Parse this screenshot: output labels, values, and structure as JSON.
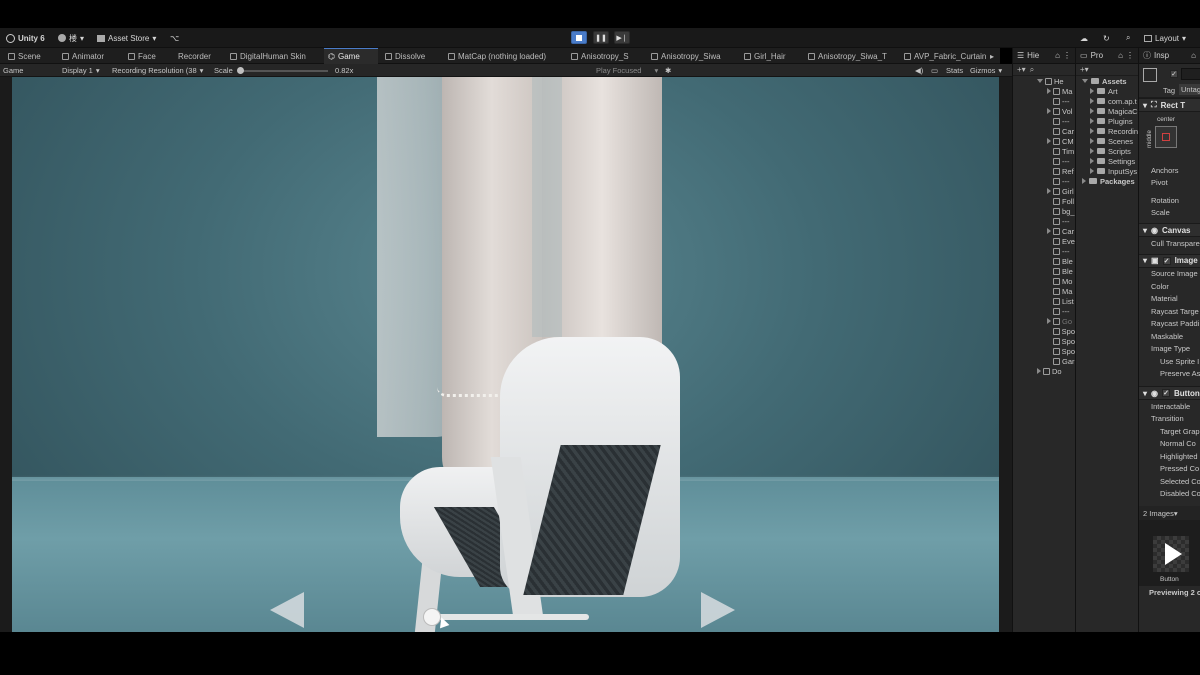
{
  "toolbar": {
    "app_name": "Unity 6",
    "account_label": "楼",
    "asset_store_label": "Asset Store",
    "layout_label": "Layout"
  },
  "tabs": [
    {
      "label": "Scene"
    },
    {
      "label": "Animator"
    },
    {
      "label": "Face"
    },
    {
      "label": "Recorder"
    },
    {
      "label": "DigitalHuman Skin"
    },
    {
      "label": "Game"
    },
    {
      "label": "Dissolve"
    },
    {
      "label": "MatCap (nothing loaded)"
    },
    {
      "label": "Anisotropy_S"
    },
    {
      "label": "Anisotropy_Siwa"
    },
    {
      "label": "Girl_Hair"
    },
    {
      "label": "Anisotropy_Siwa_T"
    },
    {
      "label": "AVP_Fabric_Curtain"
    }
  ],
  "gamebar": {
    "mode": "Game",
    "display": "Display 1",
    "resolution": "Recording Resolution (38",
    "scale_label": "Scale",
    "scale_value": "0.82x",
    "play_focused": "Play Focused",
    "stats": "Stats",
    "gizmos": "Gizmos"
  },
  "hierarchy": {
    "title": "Hie",
    "rows": [
      {
        "label": "He",
        "indent": 0,
        "fold": "open",
        "muted": false
      },
      {
        "label": "Ma",
        "indent": 1,
        "fold": "closed",
        "muted": false
      },
      {
        "label": "---",
        "indent": 1,
        "fold": "",
        "muted": false
      },
      {
        "label": "Vol",
        "indent": 1,
        "fold": "closed",
        "muted": false
      },
      {
        "label": "---",
        "indent": 1,
        "fold": "",
        "muted": false
      },
      {
        "label": "Car",
        "indent": 1,
        "fold": "",
        "muted": false
      },
      {
        "label": "CM",
        "indent": 1,
        "fold": "closed",
        "muted": false
      },
      {
        "label": "Tim",
        "indent": 1,
        "fold": "",
        "muted": false
      },
      {
        "label": "---",
        "indent": 1,
        "fold": "",
        "muted": false
      },
      {
        "label": "Ref",
        "indent": 1,
        "fold": "",
        "muted": false
      },
      {
        "label": "---",
        "indent": 1,
        "fold": "",
        "muted": false
      },
      {
        "label": "Girl",
        "indent": 1,
        "fold": "closed",
        "muted": false
      },
      {
        "label": "Foll",
        "indent": 1,
        "fold": "",
        "muted": false
      },
      {
        "label": "bg_",
        "indent": 1,
        "fold": "",
        "muted": false
      },
      {
        "label": "---",
        "indent": 1,
        "fold": "",
        "muted": false
      },
      {
        "label": "Car",
        "indent": 1,
        "fold": "closed",
        "muted": false
      },
      {
        "label": "Eve",
        "indent": 1,
        "fold": "",
        "muted": false
      },
      {
        "label": "---",
        "indent": 1,
        "fold": "",
        "muted": false
      },
      {
        "label": "Ble",
        "indent": 1,
        "fold": "",
        "muted": false
      },
      {
        "label": "Ble",
        "indent": 1,
        "fold": "",
        "muted": false
      },
      {
        "label": "Mo",
        "indent": 1,
        "fold": "",
        "muted": false
      },
      {
        "label": "Ma",
        "indent": 1,
        "fold": "",
        "muted": false
      },
      {
        "label": "List",
        "indent": 1,
        "fold": "",
        "muted": false
      },
      {
        "label": "---",
        "indent": 1,
        "fold": "",
        "muted": false
      },
      {
        "label": "Go",
        "indent": 1,
        "fold": "closed",
        "muted": true
      },
      {
        "label": "Spo",
        "indent": 1,
        "fold": "",
        "muted": false
      },
      {
        "label": "Spo",
        "indent": 1,
        "fold": "",
        "muted": false
      },
      {
        "label": "Spo",
        "indent": 1,
        "fold": "",
        "muted": false
      },
      {
        "label": "Gar",
        "indent": 1,
        "fold": "",
        "muted": false
      },
      {
        "label": "Do",
        "indent": 0,
        "fold": "closed",
        "muted": false
      }
    ]
  },
  "project": {
    "title": "Pro",
    "rows": [
      {
        "label": "Assets",
        "bold": true,
        "indent": 0
      },
      {
        "label": "Art",
        "bold": false,
        "indent": 1
      },
      {
        "label": "com.ap.t",
        "bold": false,
        "indent": 1
      },
      {
        "label": "MagicaC",
        "bold": false,
        "indent": 1
      },
      {
        "label": "Plugins",
        "bold": false,
        "indent": 1
      },
      {
        "label": "Recordin",
        "bold": false,
        "indent": 1
      },
      {
        "label": "Scenes",
        "bold": false,
        "indent": 1
      },
      {
        "label": "Scripts",
        "bold": false,
        "indent": 1
      },
      {
        "label": "Settings",
        "bold": false,
        "indent": 1
      },
      {
        "label": "InputSys",
        "bold": false,
        "indent": 1
      },
      {
        "label": "Packages",
        "bold": true,
        "indent": 0
      }
    ]
  },
  "inspector": {
    "title": "Insp",
    "tag_label": "Tag",
    "tag_value": "Untag",
    "rect_transform": "Rect T",
    "anchor_center": "center",
    "anchor_middle": "middle",
    "anchors": "Anchors",
    "pivot": "Pivot",
    "rotation": "Rotation",
    "scale": "Scale",
    "canvas_renderer": "Canvas",
    "cull_transparent": "Cull Transpare",
    "image": "Image",
    "image_fields": [
      "Source Image",
      "Color",
      "Material",
      "Raycast Targe",
      "Raycast Paddi",
      "Maskable",
      "Image Type",
      "Use Sprite I",
      "Preserve As"
    ],
    "button": "Button",
    "button_fields": [
      "Interactable",
      "Transition",
      "Target Grap",
      "Normal Co",
      "Highlighted",
      "Pressed Co",
      "Selected Co",
      "Disabled Co"
    ],
    "images_count": "2 Images",
    "preview_label": "Button",
    "previewing": "Previewing 2 o"
  }
}
